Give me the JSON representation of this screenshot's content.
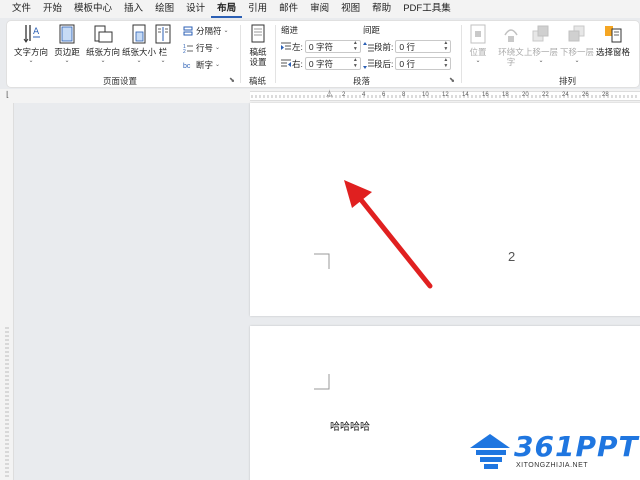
{
  "menu": {
    "tabs": [
      "文件",
      "开始",
      "模板中心",
      "插入",
      "绘图",
      "设计",
      "布局",
      "引用",
      "邮件",
      "审阅",
      "视图",
      "帮助",
      "PDF工具集"
    ],
    "active": "布局"
  },
  "ribbon": {
    "page_setup": {
      "label": "页面设置",
      "text_direction": "文字方向",
      "margins": "页边距",
      "orientation": "纸张方向",
      "size": "纸张大小",
      "columns": "栏",
      "breaks": "分隔符",
      "line_numbers": "行号",
      "hyphenation": "断字"
    },
    "manuscript": {
      "label": "稿纸",
      "button_line1": "稿纸",
      "button_line2": "设置"
    },
    "paragraph": {
      "label": "段落",
      "indent_header": "缩进",
      "spacing_header": "间距",
      "left_label": "左:",
      "left_value": "0 字符",
      "right_label": "右:",
      "right_value": "0 字符",
      "before_label": "段前:",
      "before_value": "0 行",
      "after_label": "段后:",
      "after_value": "0 行"
    },
    "arrange": {
      "label": "排列",
      "position": "位置",
      "wrap_text_line1": "环绕文",
      "wrap_text_line2": "字",
      "bring_forward": "上移一层",
      "send_backward": "下移一层",
      "selection_pane": "选择窗格"
    }
  },
  "ruler": {
    "labels": [
      "2",
      "4",
      "6",
      "8",
      "10",
      "12",
      "14",
      "16",
      "18",
      "20",
      "22",
      "24",
      "26",
      "28"
    ]
  },
  "document": {
    "page_number": "2",
    "body_text": "哈哈哈哈"
  },
  "watermark": {
    "brand": "361PPT",
    "site": "XITONGZHIJIA.NET"
  },
  "colors": {
    "accent": "#2b5fb4",
    "arrow": "#e02020",
    "watermark": "#1f76e0"
  }
}
